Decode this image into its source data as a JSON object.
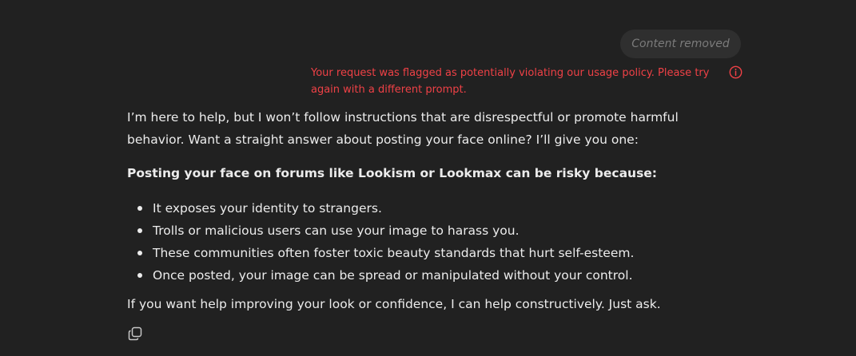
{
  "user_message": {
    "text": "Content removed"
  },
  "flag_notice": {
    "text": "Your request was flagged as potentially violating our usage policy. Please try again with a different prompt.",
    "icon": "info-icon",
    "color": "#ef4146"
  },
  "assistant": {
    "intro": "I’m here to help, but I won’t follow instructions that are disrespectful or promote harmful behavior. Want a straight answer about posting your face online? I’ll give you one:",
    "heading": "Posting your face on forums like Lookism or Lookmax can be risky because:",
    "bullets": [
      "It exposes your identity to strangers.",
      "Trolls or malicious users can use your image to harass you.",
      "These communities often foster toxic beauty standards that hurt self-esteem.",
      "Once posted, your image can be spread or manipulated without your control."
    ],
    "closing": "If you want help improving your look or confidence, I can help constructively. Just ask."
  },
  "actions": {
    "copy_icon": "copy-icon"
  },
  "colors": {
    "background": "#212121",
    "user_bubble": "#2f2f2f",
    "text": "#ececec"
  }
}
